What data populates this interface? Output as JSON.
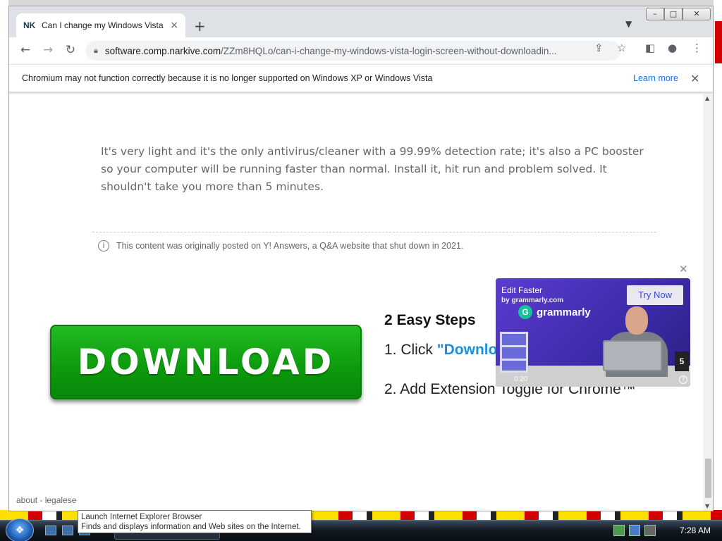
{
  "browser": {
    "tab": {
      "favicon": "NK",
      "title": "Can I change my Windows Vista",
      "close_icon": "×"
    },
    "new_tab_icon": "+",
    "window_controls": {
      "minimize": "–",
      "maximize": "□",
      "close": "✕"
    },
    "toolbar": {
      "back_icon": "←",
      "forward_icon": "→",
      "reload_icon": "↻",
      "url_host": "software.comp.narkive.com",
      "url_path": "/ZZm8HQLo/can-i-change-my-windows-vista-login-screen-without-downloadin...",
      "share_icon": "⇪",
      "bookmark_icon": "☆",
      "sidepanel_icon": "◧",
      "profile_icon": "●",
      "menu_icon": "⋮"
    },
    "infobar": {
      "message": "Chromium may not function correctly because it is no longer supported on Windows XP or Windows Vista",
      "learn_more": "Learn more",
      "close_icon": "✕"
    }
  },
  "page": {
    "answer_text": "It's very light and it's the only antivirus/cleaner with a 99.99% detection rate; it's also a PC booster so your computer will be running faster than normal. Install it, hit run and problem solved. It shouldn't take you more than 5 minutes.",
    "notice": {
      "icon": "i",
      "text": "This content was originally posted on Y! Answers, a Q&A website that shut down in 2021."
    },
    "ad": {
      "download_label": "DOWNLOAD",
      "steps_title": "2 Easy Steps",
      "step1_prefix": "1. Click ",
      "step1_link": "\"Downlo",
      "step2": "2. Add Extension Toggle for Chrome™",
      "close_icon": "✕"
    },
    "video_ad": {
      "headline": "Edit Faster",
      "by_line": "by grammarly.com",
      "brand_icon": "G",
      "brand": "grammarly",
      "cta": "Try Now",
      "time": "0:20",
      "skip_count": "5",
      "help_icon": "?"
    },
    "footer": "about - legalese"
  },
  "taskbar": {
    "clock": "7:28 AM",
    "tooltip_title": "Launch Internet Explorer Browser",
    "tooltip_body": "Finds and displays information and Web sites on the Internet."
  }
}
